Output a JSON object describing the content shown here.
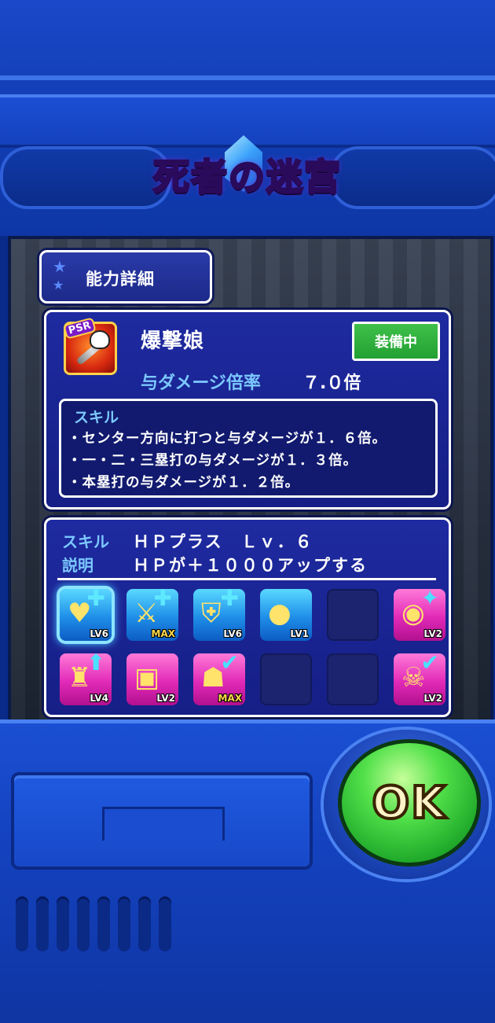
{
  "title": "死者の迷宮",
  "header_tab": {
    "label": "能力詳細"
  },
  "weapon": {
    "name": "爆撃娘",
    "rarity_badge": "PSR",
    "status": "装備中",
    "damage_label": "与ダメージ倍率",
    "damage_value": "７.０倍",
    "skill_heading": "スキル",
    "skill_lines": [
      "・センター方向に打つと与ダメージが１．６倍。",
      "・一・二・三塁打の与ダメージが１．３倍。",
      "・本塁打の与ダメージが１．２倍。"
    ]
  },
  "ability": {
    "skill_key": "スキル",
    "skill_value": "ＨＰプラス　Ｌｖ．６",
    "desc_key": "説明",
    "desc_value": "ＨＰが＋１０００アップする",
    "icons": [
      {
        "kind": "blue",
        "icon": "heart-plus-icon",
        "glyph": "♥",
        "badge": "✚",
        "level": "LV6",
        "selected": true
      },
      {
        "kind": "blue",
        "icon": "sword-plus-icon",
        "glyph": "⚔",
        "badge": "✚",
        "level": "MAX"
      },
      {
        "kind": "blue",
        "icon": "shield-plus-icon",
        "glyph": "⛨",
        "badge": "✚",
        "level": "LV6"
      },
      {
        "kind": "blue",
        "icon": "apple-icon",
        "glyph": "●",
        "badge": "",
        "level": "LV1"
      },
      {
        "kind": "empty"
      },
      {
        "kind": "pink",
        "icon": "coin-sparkle-icon",
        "glyph": "◉",
        "badge": "✦",
        "level": "LV2"
      },
      {
        "kind": "pink",
        "icon": "potion-up-icon",
        "glyph": "♜",
        "badge": "⬆",
        "level": "LV4"
      },
      {
        "kind": "pink",
        "icon": "treasure-chest-icon",
        "glyph": "▣",
        "badge": "",
        "level": "LV2"
      },
      {
        "kind": "pink",
        "icon": "monster-check-icon",
        "glyph": "☗",
        "badge": "✔",
        "level": "MAX"
      },
      {
        "kind": "empty"
      },
      {
        "kind": "empty"
      },
      {
        "kind": "pink",
        "icon": "skull-check-icon",
        "glyph": "☠",
        "badge": "✔",
        "level": "LV2"
      }
    ]
  },
  "ok_button": {
    "label": "OK"
  },
  "colors": {
    "accent_blue": "#7cc8ff",
    "equipped_green": "#22a032",
    "ok_green": "#52e04a"
  }
}
